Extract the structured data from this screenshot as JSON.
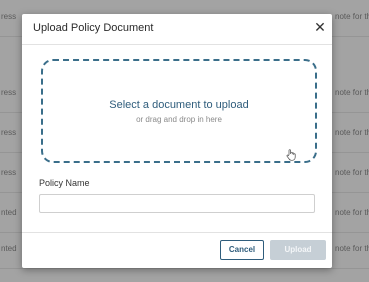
{
  "background_rows": [
    {
      "left": "ress",
      "right": "note for th"
    },
    {
      "left": "ress",
      "right": "note for th"
    },
    {
      "left": "ress",
      "right": "note for th"
    },
    {
      "left": "ress",
      "right": "note for th"
    },
    {
      "left": "nted",
      "right": "note for th"
    },
    {
      "left": "nted",
      "right": "note for th"
    }
  ],
  "modal": {
    "title": "Upload Policy Document",
    "close_label": "✕",
    "dropzone": {
      "title": "Select a document to upload",
      "subtitle": "or drag and drop in here"
    },
    "field_label": "Policy Name",
    "field_value": "",
    "cancel_label": "Cancel",
    "upload_label": "Upload"
  },
  "colors": {
    "accent": "#2f5d7c",
    "dashed_border": "#3a6e8a",
    "disabled_button": "#c6cfd6"
  }
}
